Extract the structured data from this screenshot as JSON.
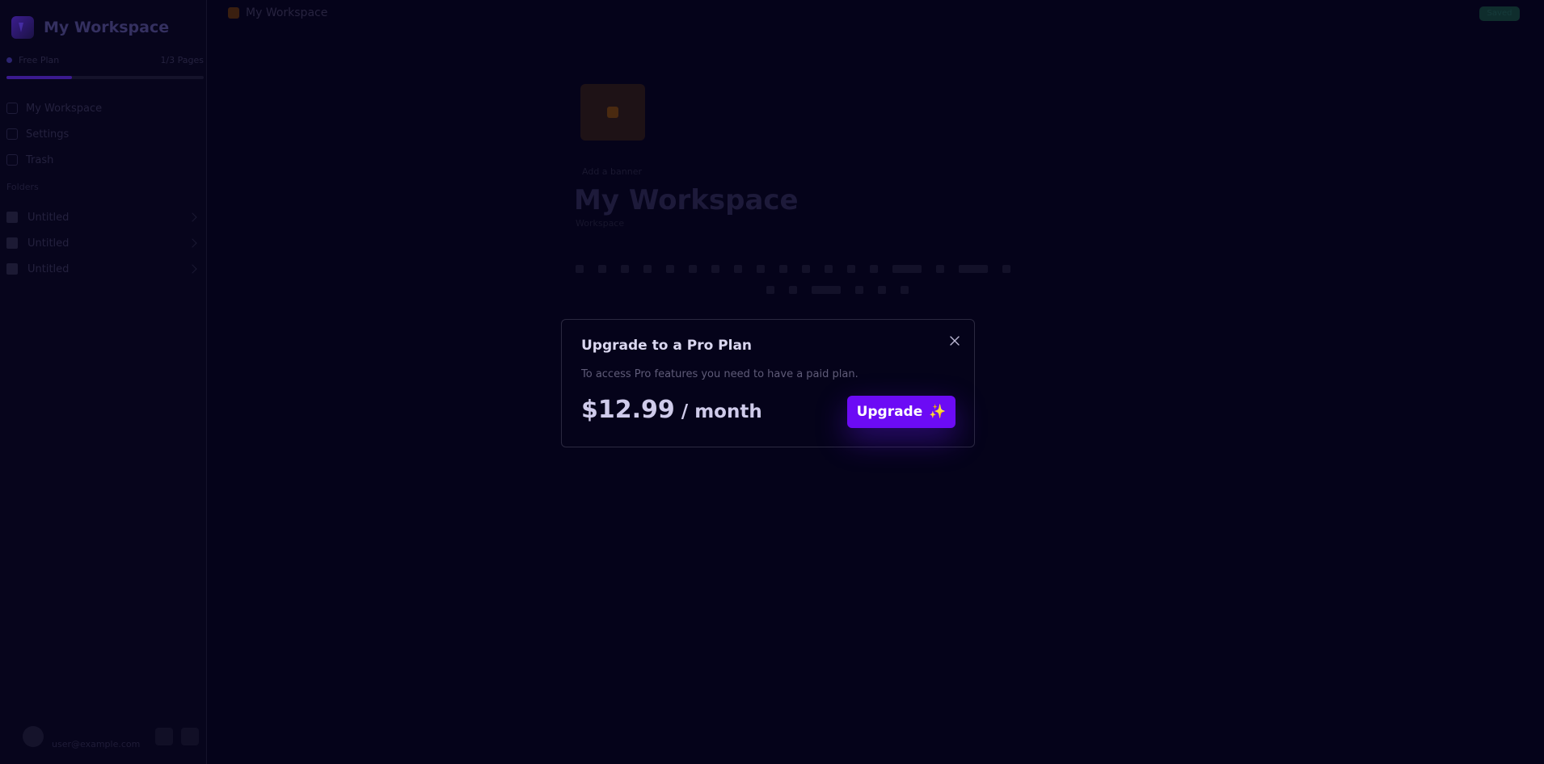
{
  "sidebar": {
    "workspace_name": "My Workspace",
    "plan": {
      "label": "Free Plan",
      "usage": "1/3 Pages",
      "progress": 0.33
    },
    "nav_items": [
      {
        "label": "My Workspace"
      },
      {
        "label": "Settings"
      },
      {
        "label": "Trash"
      }
    ],
    "section_label": "Folders",
    "folders": [
      {
        "label": "Untitled"
      },
      {
        "label": "Untitled"
      },
      {
        "label": "Untitled"
      }
    ],
    "user_email": "user@example.com"
  },
  "main": {
    "breadcrumb": "My Workspace",
    "status_badge": "Saved",
    "page_meta": "Add a banner",
    "page_title": "My Workspace",
    "page_subtitle": "Workspace"
  },
  "modal": {
    "title": "Upgrade to a Pro Plan",
    "description": "To access Pro features you need to have a paid plan.",
    "price": "$12.99",
    "price_period": " / month",
    "upgrade_label": "Upgrade",
    "upgrade_icon": "✨",
    "close_icon": "close-icon"
  },
  "colors": {
    "accent": "#6c0bf5",
    "background": "#05031a",
    "spark": "#ffc928"
  }
}
